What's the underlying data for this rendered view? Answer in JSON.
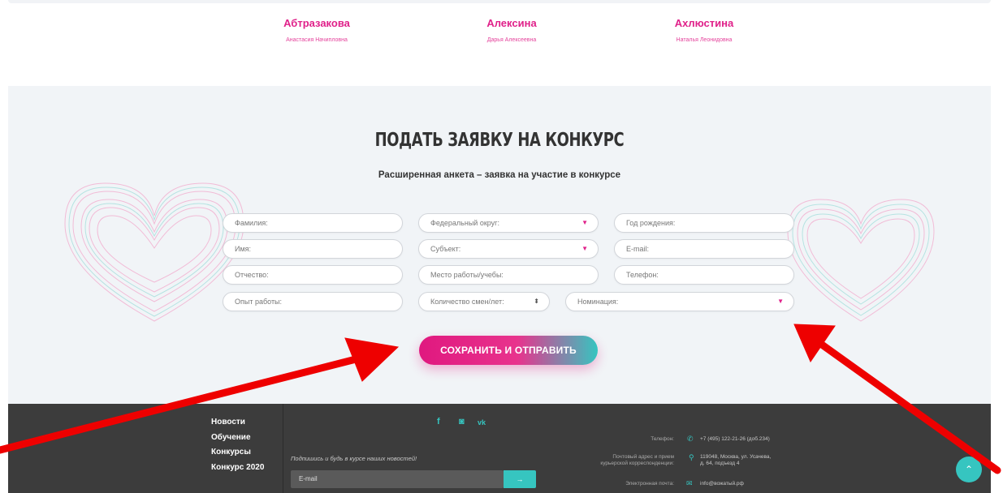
{
  "winners": [
    {
      "last_name": "Абтразакова",
      "first_names": "Анастасия Начипловна"
    },
    {
      "last_name": "Алексина",
      "first_names": "Дарья Алексеевна"
    },
    {
      "last_name": "Ахлюстина",
      "first_names": "Наталья Леонидовна"
    }
  ],
  "form": {
    "title": "ПОДАТЬ ЗАЯВКУ НА КОНКУРС",
    "subtitle": "Расширенная анкета – заявка на участие в конкурсе",
    "fields": {
      "last_name": "Фамилия:",
      "federal_district": "Федеральный округ:",
      "birth_year": "Год рождения:",
      "first_name": "Имя:",
      "subject": "Субъект:",
      "email": "E-mail:",
      "patronymic": "Отчество:",
      "workplace": "Место работы/учебы:",
      "phone": "Телефон:",
      "experience": "Опыт работы:",
      "shifts_count": "Количество смен/лет:",
      "nomination": "Номинация:"
    },
    "submit_label": "СОХРАНИТЬ И ОТПРАВИТЬ"
  },
  "footer": {
    "nav": [
      "Новости",
      "Обучение",
      "Конкурсы",
      "Конкурс 2020"
    ],
    "social": {
      "facebook": "f",
      "instagram": "◙",
      "vk": "vk"
    },
    "subscribe_text": "Подпишись и будь в курсе наших новостей!",
    "email_placeholder": "E-mail",
    "email_button": "→",
    "contacts": {
      "phone_label": "Телефон:",
      "phone_value": "+7 (495) 122-21-26 (доб.234)",
      "address_label_1": "Почтовый адрес и прием",
      "address_label_2": "курьерской корреспонденции:",
      "address_value_1": "119048, Москва, ул. Усачева,",
      "address_value_2": "д. 64, подъезд 4",
      "email_label": "Электронная почта:",
      "email_value": "info@вожатый.рф"
    }
  },
  "scroll_top_icon": "chevron-up-icon",
  "colors": {
    "accent_pink": "#e0218a",
    "accent_teal": "#36c5c0",
    "annotation_arrow": "#ee0000",
    "footer_bg": "#3c3c3c",
    "section_bg": "#f1f4f7"
  }
}
